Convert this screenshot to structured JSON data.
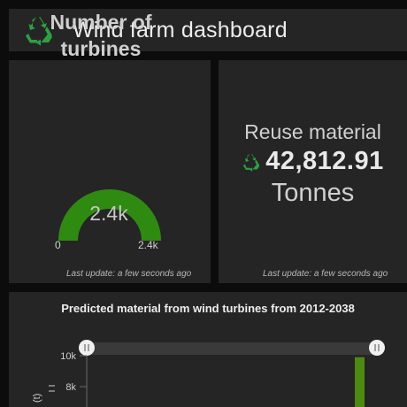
{
  "header": {
    "title": "Wind farm dashboard",
    "icon": "recycle-icon",
    "accent": "#2ea043"
  },
  "gauge_card": {
    "title": "Number of\nturbines",
    "value_label": "2.4k",
    "min_label": "0",
    "max_label": "2.4k",
    "fill_fraction": 1.0,
    "fill_color": "#2f8a12",
    "last_update": "Last update: a few seconds ago"
  },
  "reuse_card": {
    "title": "Reuse material",
    "icon": "recycle-icon",
    "value": "42,812.91",
    "unit": "Tonnes",
    "last_update": "Last update: a few seconds ago"
  },
  "chart_data": {
    "type": "bar",
    "title": "Predicted material from wind turbines from 2012-2038",
    "ylabel": "(t)",
    "ylim": [
      0,
      10000
    ],
    "yticks": [
      "10k",
      "8k"
    ],
    "series": [
      {
        "values": [
          9900
        ],
        "color": "#4d8a12"
      }
    ],
    "grid": false
  }
}
